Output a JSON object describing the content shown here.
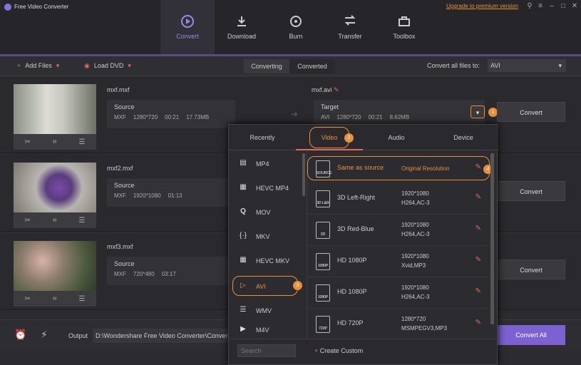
{
  "app": {
    "title": "Free Video Converter",
    "upgrade": "Upgrade to premium version"
  },
  "nav": [
    {
      "label": "Convert"
    },
    {
      "label": "Download"
    },
    {
      "label": "Burn"
    },
    {
      "label": "Transfer"
    },
    {
      "label": "Toolbox"
    }
  ],
  "toolbar": {
    "add_files": "Add Files",
    "load_dvd": "Load DVD",
    "tab_converting": "Converting",
    "tab_converted": "Converted",
    "convert_all_to": "Convert all files to:",
    "format": "AVI"
  },
  "files": [
    {
      "name": "mxf.mxf",
      "source_label": "Source",
      "format": "MXF",
      "resolution": "1280*720",
      "duration": "00:21",
      "size": "17.73MB",
      "target_name": "mxf.avi",
      "target_label": "Target",
      "target_format": "AVI",
      "target_resolution": "1280*720",
      "target_duration": "00:21",
      "target_size": "8.62MB",
      "convert": "Convert"
    },
    {
      "name": "mxf2.mxf",
      "source_label": "Source",
      "format": "MXF",
      "resolution": "1920*1080",
      "duration": "01:13",
      "convert": "Convert"
    },
    {
      "name": "mxf3.mxf",
      "source_label": "Source",
      "format": "MXF",
      "resolution": "720*480",
      "duration": "03:17",
      "convert": "Convert"
    }
  ],
  "popup": {
    "tabs": [
      "Recently",
      "Video",
      "Audio",
      "Device"
    ],
    "formats": [
      "MP4",
      "HEVC MP4",
      "MOV",
      "MKV",
      "HEVC MKV",
      "AVI",
      "WMV",
      "M4V"
    ],
    "format_icons": [
      "film-icon",
      "hevc-icon",
      "mov-icon",
      "mkv-icon",
      "hevc-icon",
      "play-circle-icon",
      "wmv-icon",
      "m4v-icon"
    ],
    "presets": [
      {
        "name": "Same as source",
        "detail1": "Original Resolution",
        "detail2": "",
        "icon_text": "SOURCE"
      },
      {
        "name": "3D Left-Right",
        "detail1": "1920*1080",
        "detail2": "H264,AC-3",
        "icon_text": "3D L&R"
      },
      {
        "name": "3D Red-Blue",
        "detail1": "1920*1080",
        "detail2": "H264,AC-3",
        "icon_text": "3D"
      },
      {
        "name": "HD 1080P",
        "detail1": "1920*1080",
        "detail2": "Xvid,MP3",
        "icon_text": "1080P"
      },
      {
        "name": "HD 1080P",
        "detail1": "1920*1080",
        "detail2": "H264,AC-3",
        "icon_text": "1080P"
      },
      {
        "name": "HD 720P",
        "detail1": "1280*720",
        "detail2": "MSMPEGV3,MP3",
        "icon_text": "720P"
      }
    ],
    "search_placeholder": "Search",
    "create_custom": "Create Custom"
  },
  "badges": [
    "1",
    "2",
    "3",
    "4"
  ],
  "bottom": {
    "output_label": "Output",
    "output_path": "D:\\Wondershare Free Video Converter\\Converted",
    "convert_all": "Convert All"
  },
  "colors": {
    "accent": "#7b61d1",
    "highlight": "#e8903a",
    "red": "#e06a55"
  }
}
